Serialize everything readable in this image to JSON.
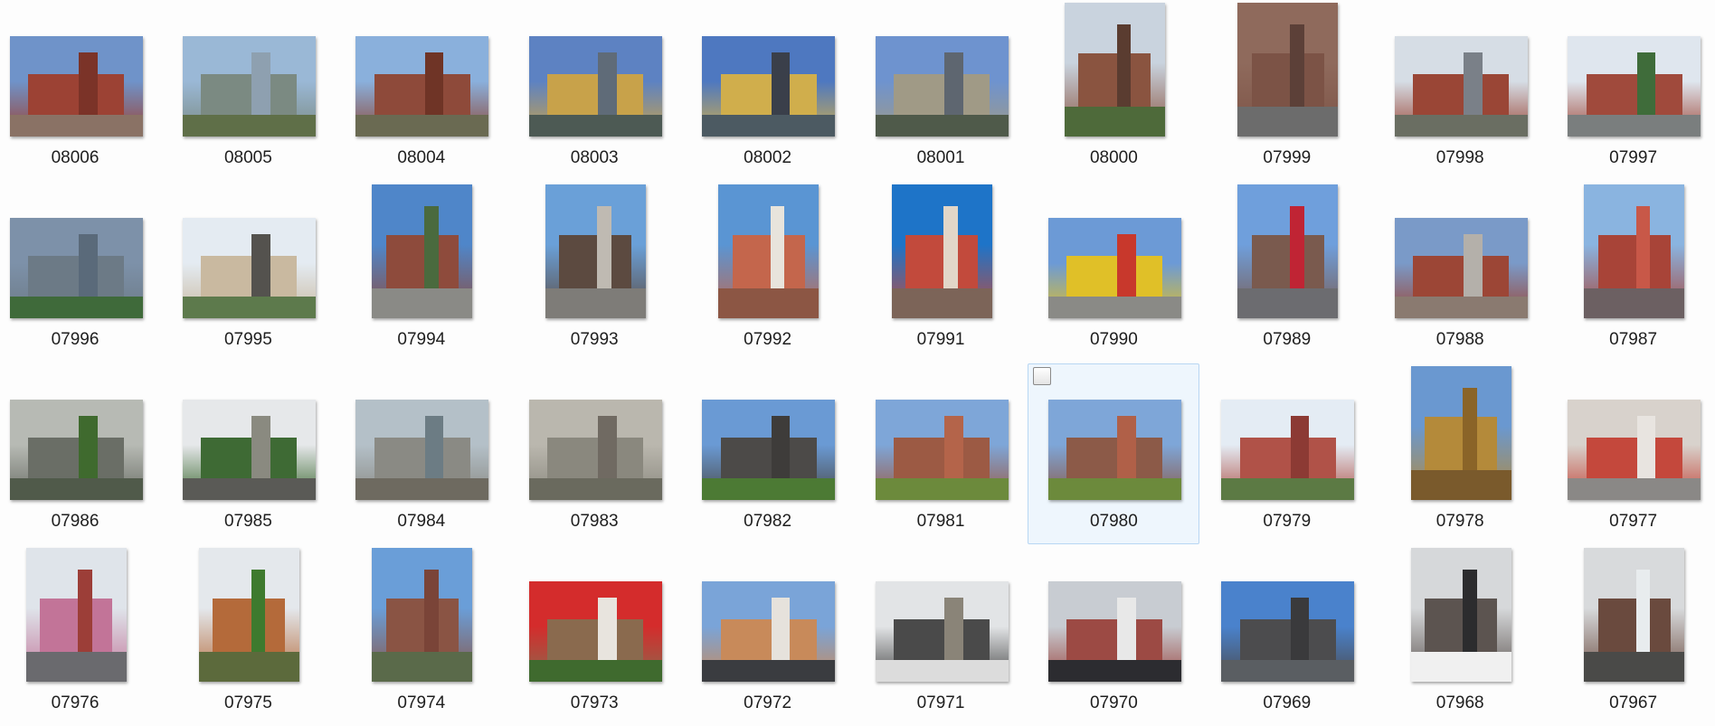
{
  "folder": {
    "selected_item": "07980",
    "items": [
      {
        "name": "08006",
        "orientation": "landscape",
        "sky": "#6f93c9",
        "ground": "#8a7265",
        "mass": "#9c4234",
        "tower": "#7b3328"
      },
      {
        "name": "08005",
        "orientation": "landscape",
        "sky": "#9ab8d6",
        "ground": "#5f6f48",
        "mass": "#7b8a82",
        "tower": "#8ea0b0"
      },
      {
        "name": "08004",
        "orientation": "landscape",
        "sky": "#8ab0dc",
        "ground": "#6a6a52",
        "mass": "#8e4a3a",
        "tower": "#6f3426"
      },
      {
        "name": "08003",
        "orientation": "landscape",
        "sky": "#5d82c2",
        "ground": "#4d5a54",
        "mass": "#c8a24a",
        "tower": "#5f6b78"
      },
      {
        "name": "08002",
        "orientation": "landscape",
        "sky": "#4e78c0",
        "ground": "#4c5a62",
        "mass": "#d0ae4c",
        "tower": "#3a3f4a"
      },
      {
        "name": "08001",
        "orientation": "landscape",
        "sky": "#6e93cf",
        "ground": "#4f5a4a",
        "mass": "#a09a86",
        "tower": "#5e6670"
      },
      {
        "name": "08000",
        "orientation": "portrait",
        "sky": "#c9d3de",
        "ground": "#4e6a3a",
        "mass": "#8a5440",
        "tower": "#5a3c30"
      },
      {
        "name": "07999",
        "orientation": "portrait",
        "sky": "#8f6a5c",
        "ground": "#6c6c6c",
        "mass": "#7c5346",
        "tower": "#5c4038"
      },
      {
        "name": "07998",
        "orientation": "landscape",
        "sky": "#d6dde5",
        "ground": "#6a6e62",
        "mass": "#9a4636",
        "tower": "#7a8088"
      },
      {
        "name": "07997",
        "orientation": "landscape",
        "sky": "#dfe6ee",
        "ground": "#7a7e7e",
        "mass": "#a04a3c",
        "tower": "#3f6c3a"
      },
      {
        "name": "07996",
        "orientation": "landscape",
        "sky": "#7d91a9",
        "ground": "#3f6a3a",
        "mass": "#6c7a86",
        "tower": "#5a6a7a"
      },
      {
        "name": "07995",
        "orientation": "landscape",
        "sky": "#e4ebf2",
        "ground": "#5d7a4c",
        "mass": "#c9b9a0",
        "tower": "#54524e"
      },
      {
        "name": "07994",
        "orientation": "portrait",
        "sky": "#4f86c9",
        "ground": "#8a8a86",
        "mass": "#8e4b3c",
        "tower": "#4a6a3e"
      },
      {
        "name": "07993",
        "orientation": "portrait",
        "sky": "#6aa0d8",
        "ground": "#7e7c78",
        "mass": "#5c4a40",
        "tower": "#bfbab2"
      },
      {
        "name": "07992",
        "orientation": "portrait",
        "sky": "#5a95d3",
        "ground": "#8c5644",
        "mass": "#c4664c",
        "tower": "#e8e4dc"
      },
      {
        "name": "07991",
        "orientation": "portrait",
        "sky": "#1e74c8",
        "ground": "#7c6458",
        "mass": "#c24a3c",
        "tower": "#e2d6c8"
      },
      {
        "name": "07990",
        "orientation": "landscape",
        "sky": "#6c9ad6",
        "ground": "#8a8a86",
        "mass": "#e0c028",
        "tower": "#c8382c"
      },
      {
        "name": "07989",
        "orientation": "portrait",
        "sky": "#6f9fdc",
        "ground": "#6c6c70",
        "mass": "#7a5a4e",
        "tower": "#c02434"
      },
      {
        "name": "07988",
        "orientation": "landscape",
        "sky": "#7a9ac8",
        "ground": "#8a7a70",
        "mass": "#9c4636",
        "tower": "#b4b0aa"
      },
      {
        "name": "07987",
        "orientation": "portrait",
        "sky": "#8ab4e0",
        "ground": "#6c6062",
        "mass": "#a84438",
        "tower": "#c85848"
      },
      {
        "name": "07986",
        "orientation": "landscape",
        "sky": "#b7bab4",
        "ground": "#505a4a",
        "mass": "#6a6e66",
        "tower": "#3f6a2e"
      },
      {
        "name": "07985",
        "orientation": "landscape",
        "sky": "#e6e8ea",
        "ground": "#5a5a56",
        "mass": "#3e6a34",
        "tower": "#8a8a80"
      },
      {
        "name": "07984",
        "orientation": "landscape",
        "sky": "#b4c0c8",
        "ground": "#6e6a60",
        "mass": "#8a8a84",
        "tower": "#6c7c84"
      },
      {
        "name": "07983",
        "orientation": "landscape",
        "sky": "#bab7ae",
        "ground": "#6a6a5e",
        "mass": "#8a887e",
        "tower": "#706a62"
      },
      {
        "name": "07982",
        "orientation": "landscape",
        "sky": "#6a9ad4",
        "ground": "#4c7a34",
        "mass": "#4c4a48",
        "tower": "#3e3c3a"
      },
      {
        "name": "07981",
        "orientation": "landscape",
        "sky": "#7ea6d8",
        "ground": "#6c8a3c",
        "mass": "#9c5a44",
        "tower": "#b4644a"
      },
      {
        "name": "07980",
        "orientation": "landscape",
        "sky": "#7ea6d8",
        "ground": "#6c8a3c",
        "mass": "#8c5a48",
        "tower": "#b06048"
      },
      {
        "name": "07979",
        "orientation": "landscape",
        "sky": "#e4ecf4",
        "ground": "#5c7a44",
        "mass": "#b05248",
        "tower": "#8c3a34"
      },
      {
        "name": "07978",
        "orientation": "portrait",
        "sky": "#6a98d0",
        "ground": "#7a5a2c",
        "mass": "#b48a3a",
        "tower": "#8a6428"
      },
      {
        "name": "07977",
        "orientation": "landscape",
        "sky": "#d8d2cc",
        "ground": "#8a8886",
        "mass": "#c4483c",
        "tower": "#e8e4e0"
      },
      {
        "name": "07976",
        "orientation": "portrait",
        "sky": "#dfe4ea",
        "ground": "#6a6a6e",
        "mass": "#c27498",
        "tower": "#9c3e38"
      },
      {
        "name": "07975",
        "orientation": "portrait",
        "sky": "#e4e8ec",
        "ground": "#5c6a3c",
        "mass": "#b46a3a",
        "tower": "#3e7a2e"
      },
      {
        "name": "07974",
        "orientation": "portrait",
        "sky": "#6a9ed8",
        "ground": "#5a6a4a",
        "mass": "#8a5444",
        "tower": "#7a4438"
      },
      {
        "name": "07973",
        "orientation": "landscape",
        "sky": "#d42c2c",
        "ground": "#3f6a2e",
        "mass": "#8a6a4e",
        "tower": "#e8e4de"
      },
      {
        "name": "07972",
        "orientation": "landscape",
        "sky": "#7aa4d8",
        "ground": "#3a3c40",
        "mass": "#c88a5a",
        "tower": "#e6e2dc"
      },
      {
        "name": "07971",
        "orientation": "landscape",
        "sky": "#e2e4e6",
        "ground": "#dcdcdc",
        "mass": "#4a4a4a",
        "tower": "#8a8478"
      },
      {
        "name": "07970",
        "orientation": "landscape",
        "sky": "#c8ccd2",
        "ground": "#2c2c30",
        "mass": "#9c4a44",
        "tower": "#e8e8e8"
      },
      {
        "name": "07969",
        "orientation": "landscape",
        "sky": "#4a82cc",
        "ground": "#5a5e62",
        "mass": "#4c4c4e",
        "tower": "#3a3a3c"
      },
      {
        "name": "07968",
        "orientation": "portrait",
        "sky": "#d6d8da",
        "ground": "#f0f0f0",
        "mass": "#5c5450",
        "tower": "#2c2c2e"
      },
      {
        "name": "07967",
        "orientation": "portrait",
        "sky": "#d8dadc",
        "ground": "#4a4a48",
        "mass": "#6a4a3e",
        "tower": "#e8ecee"
      }
    ]
  }
}
